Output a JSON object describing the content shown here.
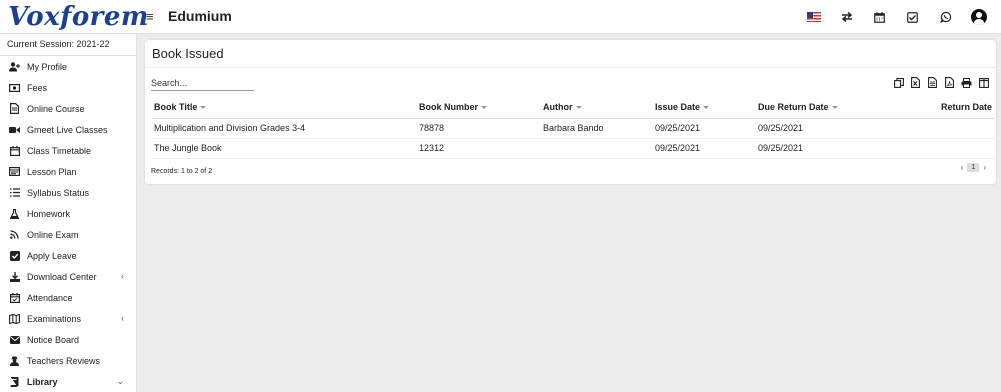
{
  "header": {
    "logo": "Voxforem",
    "app_name": "Edumium",
    "icons": [
      "us-flag-icon",
      "swap-icon",
      "calendar-icon",
      "checklist-icon",
      "whatsapp-icon",
      "user-avatar-icon"
    ]
  },
  "sidebar": {
    "session": "Current Session: 2021-22",
    "items": [
      {
        "label": "My Profile",
        "icon": "user-plus-icon"
      },
      {
        "label": "Fees",
        "icon": "money-icon"
      },
      {
        "label": "Online Course",
        "icon": "file-icon"
      },
      {
        "label": "Gmeet Live Classes",
        "icon": "video-icon"
      },
      {
        "label": "Class Timetable",
        "icon": "calendar-icon"
      },
      {
        "label": "Lesson Plan",
        "icon": "lesson-icon"
      },
      {
        "label": "Syllabus Status",
        "icon": "list-icon"
      },
      {
        "label": "Homework",
        "icon": "flask-icon"
      },
      {
        "label": "Online Exam",
        "icon": "rss-icon"
      },
      {
        "label": "Apply Leave",
        "icon": "check-square-icon"
      },
      {
        "label": "Download Center",
        "icon": "download-icon"
      },
      {
        "label": "Attendance",
        "icon": "calendar-check-icon"
      },
      {
        "label": "Examinations",
        "icon": "map-icon"
      },
      {
        "label": "Notice Board",
        "icon": "envelope-icon"
      },
      {
        "label": "Teachers Reviews",
        "icon": "user-secret-icon"
      },
      {
        "label": "Library",
        "icon": "book-icon"
      }
    ]
  },
  "main": {
    "title": "Book Issued",
    "search_placeholder": "Search...",
    "toolbar": [
      "copy-icon",
      "excel-icon",
      "csv-icon",
      "pdf-icon",
      "print-icon",
      "columns-icon"
    ],
    "columns": [
      "Book Title",
      "Book Number",
      "Author",
      "Issue Date",
      "Due Return Date",
      "Return Date"
    ],
    "rows": [
      [
        "Multiplication and Division Grades 3-4",
        "78878",
        "Barbara Bando",
        "09/25/2021",
        "09/25/2021",
        ""
      ],
      [
        "The Jungle Book",
        "12312",
        "",
        "09/25/2021",
        "09/25/2021",
        ""
      ]
    ],
    "records": "Records: 1 to 2 of 2",
    "pager": {
      "prev": "‹",
      "page": "1",
      "next": "›"
    }
  },
  "colors": {
    "logo": "#1d3f8f",
    "background": "#ececec",
    "card": "#ffffff"
  }
}
